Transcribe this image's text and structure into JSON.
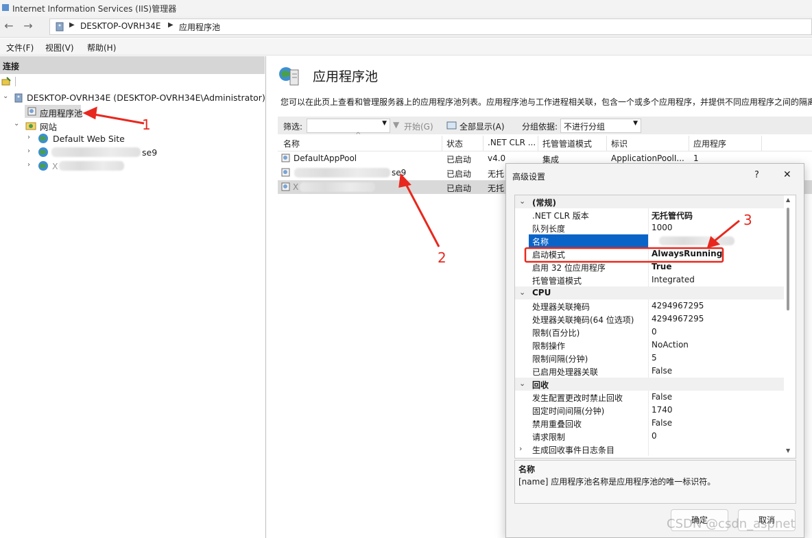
{
  "window": {
    "title": "Internet Information Services (IIS)管理器"
  },
  "address": {
    "path": [
      "DESKTOP-OVRH34E",
      "应用程序池"
    ]
  },
  "menu": [
    "文件(F)",
    "视图(V)",
    "帮助(H)"
  ],
  "connections": {
    "header": "连接",
    "server": "DESKTOP-OVRH34E (DESKTOP-OVRH34E\\Administrator)",
    "app_pools": "应用程序池",
    "sites": "网站",
    "site1": "Default Web Site",
    "site2_suffix": "se9",
    "site3_prefix": "X"
  },
  "main": {
    "title": "应用程序池",
    "description": "您可以在此页上查看和管理服务器上的应用程序池列表。应用程序池与工作进程相关联，包含一个或多个应用程序，并提供不同应用程序之间的隔离",
    "filter": {
      "label": "筛选:",
      "start": "开始(G)",
      "show_all": "全部显示(A)",
      "group_label": "分组依据:",
      "group_value": "不进行分组"
    },
    "columns": [
      "名称",
      "状态",
      ".NET CLR ...",
      "托管管道模式",
      "标识",
      "应用程序"
    ],
    "rows": [
      {
        "name": "DefaultAppPool",
        "status": "已启动",
        "clr": "v4.0",
        "pipeline": "集成",
        "identity": "ApplicationPoolI...",
        "apps": "1"
      },
      {
        "name": "se9",
        "status": "已启动",
        "clr": "无托",
        "pipeline": "",
        "identity": "",
        "apps": ""
      },
      {
        "name": "X",
        "status": "已启动",
        "clr": "无托",
        "pipeline": "",
        "identity": "",
        "apps": ""
      }
    ]
  },
  "dialog": {
    "title": "高级设置",
    "help": "?",
    "close": "✕",
    "sections": [
      {
        "name": "(常规)",
        "rows": [
          {
            "k": ".NET CLR 版本",
            "v": "无托管代码",
            "bold": true
          },
          {
            "k": "队列长度",
            "v": "1000"
          },
          {
            "k": "名称",
            "v": "",
            "selected": true
          },
          {
            "k": "启动模式",
            "v": "AlwaysRunning",
            "bold": true,
            "highlight": true
          },
          {
            "k": "启用 32 位应用程序",
            "v": "True",
            "bold": true
          },
          {
            "k": "托管管道模式",
            "v": "Integrated"
          }
        ]
      },
      {
        "name": "CPU",
        "rows": [
          {
            "k": "处理器关联掩码",
            "v": "4294967295"
          },
          {
            "k": "处理器关联掩码(64 位选项)",
            "v": "4294967295"
          },
          {
            "k": "限制(百分比)",
            "v": "0"
          },
          {
            "k": "限制操作",
            "v": "NoAction"
          },
          {
            "k": "限制间隔(分钟)",
            "v": "5"
          },
          {
            "k": "已启用处理器关联",
            "v": "False"
          }
        ]
      },
      {
        "name": "回收",
        "rows": [
          {
            "k": "发生配置更改时禁止回收",
            "v": "False"
          },
          {
            "k": "固定时间间隔(分钟)",
            "v": "1740"
          },
          {
            "k": "禁用重叠回收",
            "v": "False"
          },
          {
            "k": "请求限制",
            "v": "0"
          },
          {
            "k": "生成回收事件日志条目",
            "v": "",
            "expandable": true
          }
        ]
      }
    ],
    "desc_title": "名称",
    "desc_text": "[name] 应用程序池名称是应用程序池的唯一标识符。",
    "ok": "确定",
    "cancel": "取消"
  },
  "annotations": {
    "one": "1",
    "two": "2",
    "three": "3",
    "color": "#e8281e"
  },
  "watermark": "CSDN @csdn_aspnet"
}
